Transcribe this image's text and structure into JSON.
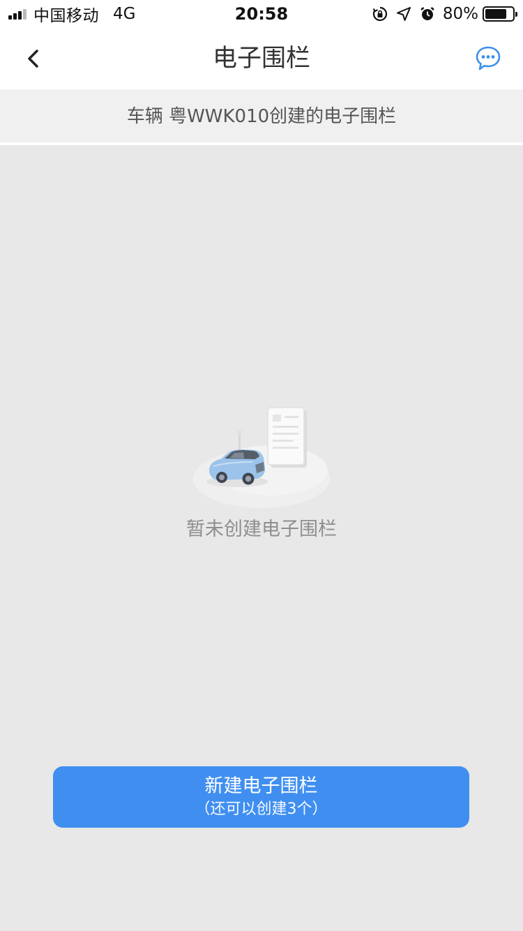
{
  "status_bar": {
    "carrier": "中国移动",
    "network": "4G",
    "time": "20:58",
    "battery_percent": "80%",
    "battery_level": 0.8,
    "icons": [
      "orientation-lock-icon",
      "location-arrow-icon",
      "alarm-icon"
    ]
  },
  "nav": {
    "title": "电子围栏",
    "back_icon": "chevron-left-icon",
    "action_icon": "chat-bubble-icon"
  },
  "subtitle": "车辆 粤WWK010创建的电子围栏",
  "empty_state": {
    "illustration": "car-document-illustration",
    "message": "暂未创建电子围栏"
  },
  "primary_button": {
    "label": "新建电子围栏",
    "sub_label": "（还可以创建3个）"
  },
  "colors": {
    "accent": "#408ff0",
    "background": "#e8e8e8",
    "header": "#ffffff"
  }
}
